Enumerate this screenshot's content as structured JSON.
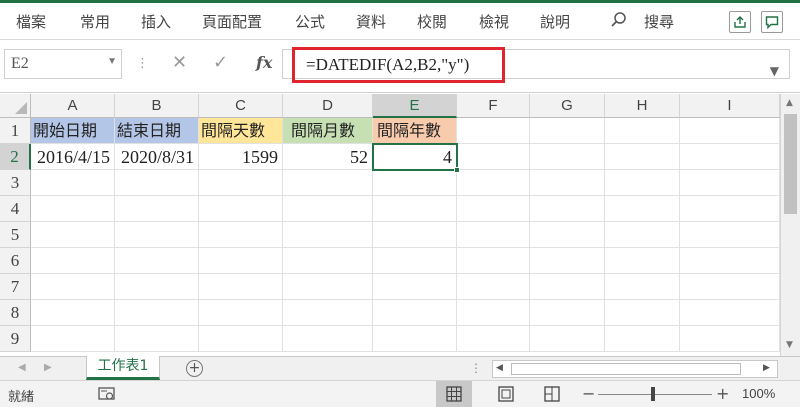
{
  "ribbon": {
    "tabs": [
      "檔案",
      "常用",
      "插入",
      "頁面配置",
      "公式",
      "資料",
      "校閱",
      "檢視",
      "說明"
    ],
    "search_label": "搜尋"
  },
  "formula_bar": {
    "name_box": "E2",
    "fx_label": "fx",
    "formula": "=DATEDIF(A2,B2,\"y\")"
  },
  "grid": {
    "columns": [
      "A",
      "B",
      "C",
      "D",
      "E",
      "F",
      "G",
      "H",
      "I"
    ],
    "rows": [
      "1",
      "2",
      "3",
      "4",
      "5",
      "6",
      "7",
      "8",
      "9"
    ],
    "header_row": [
      "開始日期",
      "結束日期",
      "間隔天數",
      "間隔月數",
      "間隔年數"
    ],
    "data_row": [
      "2016/4/15",
      "2020/8/31",
      "1599",
      "52",
      "4"
    ],
    "header_colors": [
      "#b4c6e7",
      "#b4c6e7",
      "#ffe699",
      "#c6e0b4",
      "#f8cbad"
    ],
    "active_cell": "E2"
  },
  "sheets": {
    "tabs": [
      "工作表1"
    ]
  },
  "status": {
    "ready": "就緒",
    "zoom": "100%"
  },
  "colors": {
    "accent": "#217346",
    "highlight": "#e0242e"
  }
}
